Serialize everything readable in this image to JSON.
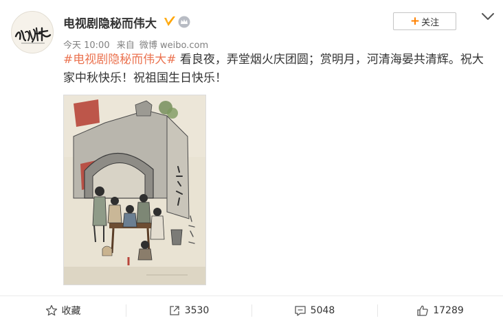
{
  "post": {
    "user_name": "电视剧隐秘而伟大",
    "time": "今天 10:00",
    "source_prefix": "来自",
    "source": "微博 weibo.com",
    "hashtag": "#电视剧隐秘而伟大#",
    "text": " 看良夜，弄堂烟火庆团圆；赏明月，河清海晏共清辉。祝大家中秋快乐！祝祖国生日快乐！",
    "follow_label": "关注",
    "follow_plus": "+"
  },
  "actions": {
    "favorite": "收藏",
    "repost": "3530",
    "comment": "5048",
    "like": "17289"
  },
  "colors": {
    "hashtag": "#eb7350",
    "follow_plus": "#ff8200",
    "verified": "#ffa500"
  },
  "icons": [
    "more-chevron-icon",
    "verified-icon",
    "crown-icon",
    "star-icon",
    "repost-icon",
    "comment-icon",
    "like-icon"
  ]
}
